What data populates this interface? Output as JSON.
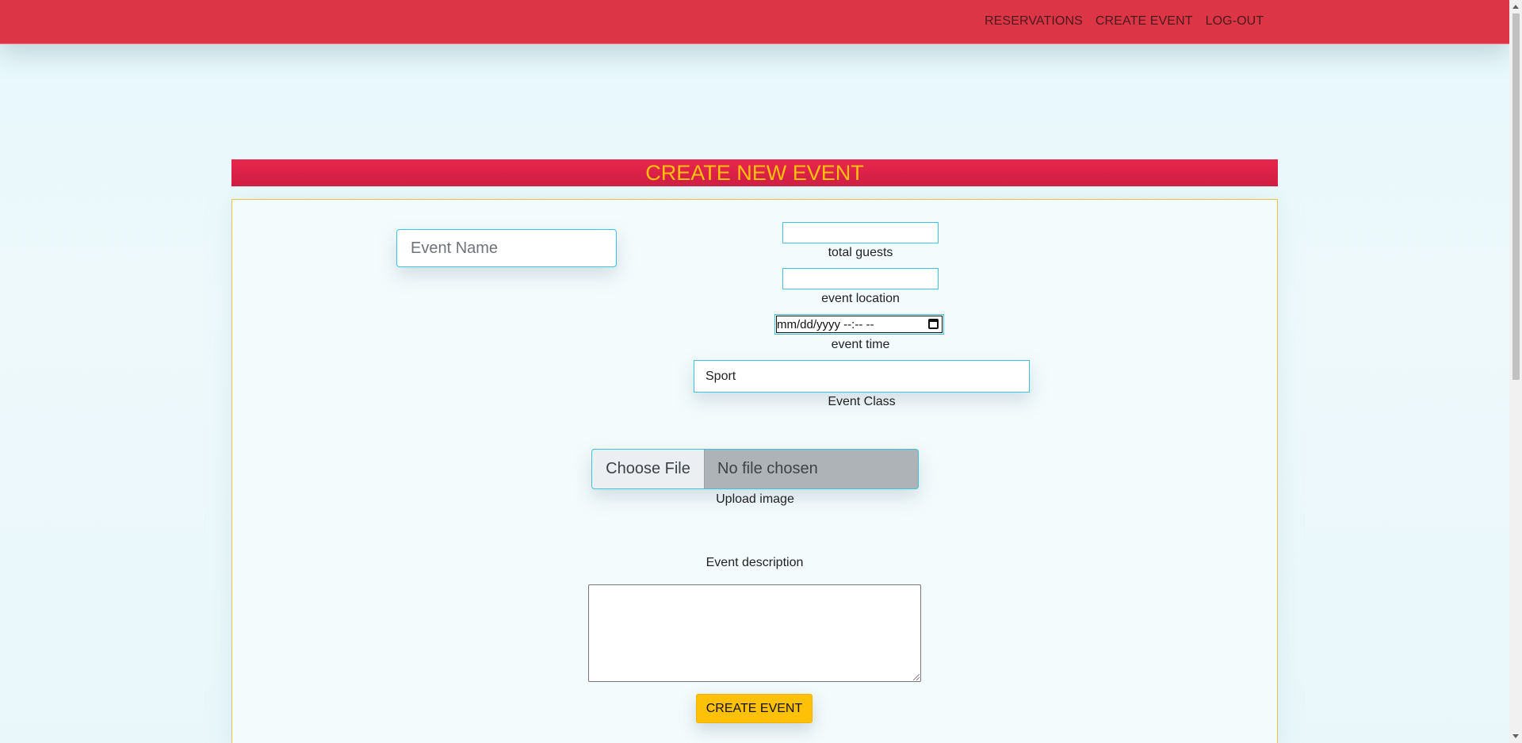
{
  "nav": {
    "links": [
      "RESERVATIONS",
      "CREATE EVENT",
      "LOG-OUT"
    ]
  },
  "form": {
    "title": "CREATE NEW EVENT",
    "event_name_placeholder": "Event Name",
    "total_guests": {
      "value": "",
      "label": "total guests"
    },
    "event_location": {
      "value": "",
      "label": "event location"
    },
    "event_time": {
      "value": "mm/dd/yyyy --:-- --",
      "label": "event time"
    },
    "event_class": {
      "value": "Sport",
      "label": "Event Class"
    },
    "upload": {
      "button": "Choose File",
      "status": "No file chosen",
      "label": "Upload image"
    },
    "description": {
      "label": "Event description",
      "value": ""
    },
    "submit_label": "CREATE EVENT"
  },
  "colors": {
    "navbar": "#dc3545",
    "header": "#e8274e",
    "title_text": "#ffc107",
    "accent_border": "#3bc3df",
    "button": "#ffc107"
  }
}
